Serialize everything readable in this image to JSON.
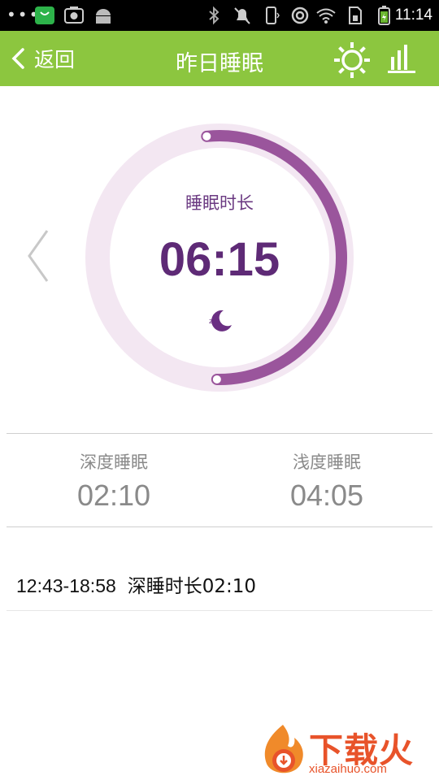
{
  "status_bar": {
    "dots": "•••",
    "time": "11:14"
  },
  "header": {
    "back_label": "返回",
    "title": "昨日睡眠"
  },
  "sleep": {
    "label": "睡眠时长",
    "total": "06:15",
    "progress_fraction": 0.52
  },
  "summary": {
    "deep_label": "深度睡眠",
    "deep_value": "02:10",
    "light_label": "浅度睡眠",
    "light_value": "04:05"
  },
  "records": [
    {
      "range": "12:43-18:58",
      "text": "深睡时长02:10"
    }
  ],
  "watermark": {
    "brand": "下载火",
    "site": "xiazaihuo.com"
  },
  "colors": {
    "header": "#8cc63f",
    "ring_track": "#f3e7f2",
    "ring_progress": "#9a559c",
    "value_text": "#5e2a76"
  }
}
